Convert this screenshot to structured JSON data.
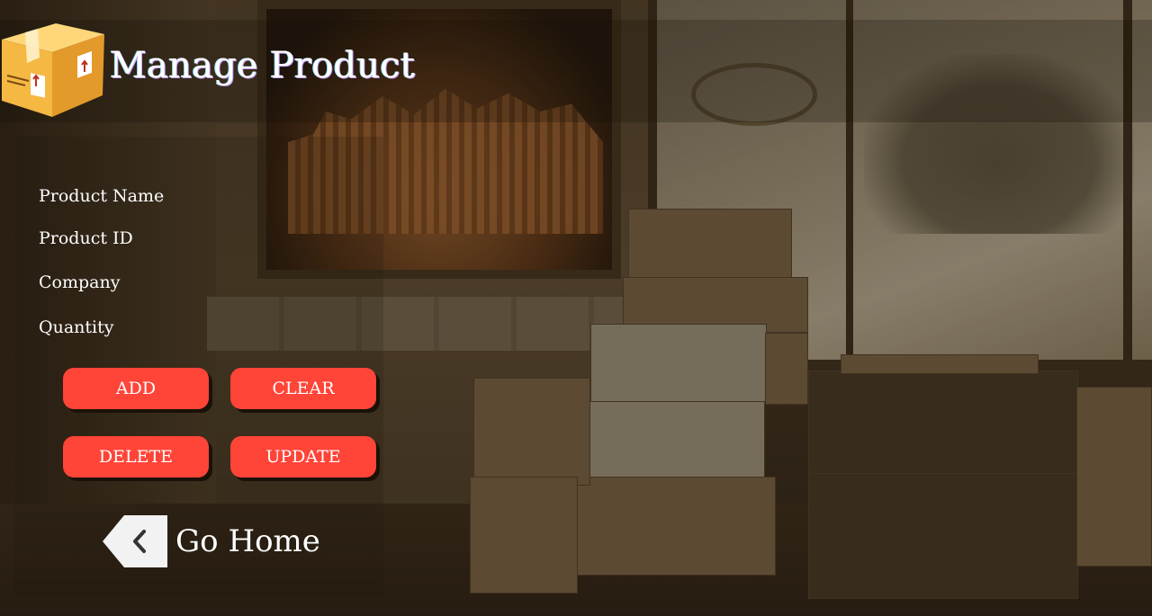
{
  "header": {
    "title": "Manage Product",
    "logo_icon": "package-box-icon"
  },
  "form": {
    "fields": [
      {
        "label": "Product Name"
      },
      {
        "label": "Product ID"
      },
      {
        "label": "Company"
      },
      {
        "label": "Quantity"
      }
    ]
  },
  "actions": {
    "add_label": "ADD",
    "clear_label": "CLEAR",
    "delete_label": "DELETE",
    "update_label": "UPDATE"
  },
  "nav": {
    "home_label": "Go Home",
    "home_icon": "chevron-left-icon"
  },
  "colors": {
    "button_bg": "#ff4438",
    "button_text": "#ffffff",
    "label_text": "#ffffff",
    "box_icon_fill": "#f5b843"
  }
}
